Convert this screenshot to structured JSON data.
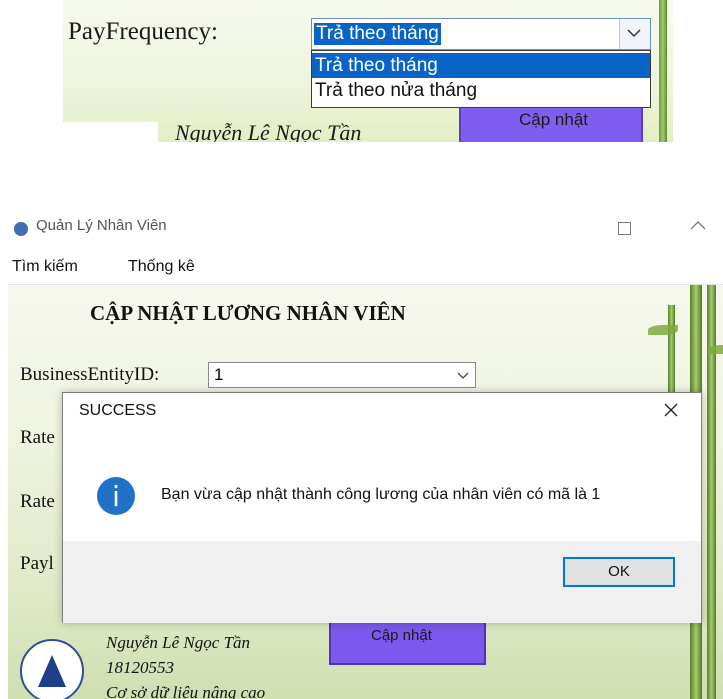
{
  "top_crop": {
    "pay_frequency_label": "PayFrequency:",
    "selected_value": "Trả theo tháng",
    "options": [
      "Trả theo tháng",
      "Trả theo nửa tháng"
    ],
    "button_label": "Cập nhật",
    "signature_name": "Nguyễn Lê Ngọc Tần"
  },
  "window": {
    "title": "Quản Lý Nhân Viên",
    "menu": [
      "Tìm kiếm",
      "Thống kê"
    ]
  },
  "form": {
    "title": "CẬP NHẬT LƯƠNG NHÂN VIÊN",
    "business_entity_label": "BusinessEntityID:",
    "business_entity_value": "1",
    "rate_label_1": "Rate",
    "rate_label_2": "Rate",
    "pay_label_partial": "Payl",
    "update_button": "Cập nhật",
    "signature": {
      "name": "Nguyễn Lê Ngọc Tần",
      "student_id": "18120553",
      "course": "Cơ sở dữ liệu nâng cao"
    }
  },
  "dialog": {
    "title": "SUCCESS",
    "icon": "info-icon",
    "message": "Bạn vừa cập nhật thành công lương của nhân viên có mã là 1",
    "ok_label": "OK"
  },
  "colors": {
    "selection_blue": "#0a64c8",
    "button_purple": "#7b58ee",
    "info_blue": "#1f72c8",
    "ok_border": "#0078d7"
  }
}
